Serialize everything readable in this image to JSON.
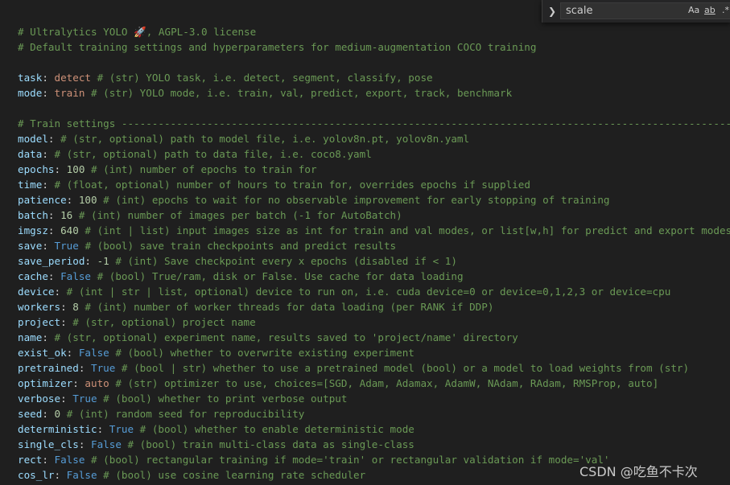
{
  "find_widget": {
    "query": "scale",
    "match_case_label": "Aa",
    "whole_word_label": "ab",
    "regex_label": ".*",
    "toggle_icon": "chevron-right-icon"
  },
  "watermark": "CSDN @吃鱼不卡次",
  "lines": [
    [
      {
        "t": "# Ultralytics YOLO 🚀, AGPL-3.0 license",
        "c": "comment"
      }
    ],
    [
      {
        "t": "# Default training settings and hyperparameters for medium-augmentation COCO training",
        "c": "comment"
      }
    ],
    [],
    [
      {
        "t": "task",
        "c": "key"
      },
      {
        "t": ": ",
        "c": "punct"
      },
      {
        "t": "detect",
        "c": "str"
      },
      {
        "t": " # (str) YOLO task, i.e. detect, segment, classify, pose",
        "c": "comment"
      }
    ],
    [
      {
        "t": "mode",
        "c": "key"
      },
      {
        "t": ": ",
        "c": "punct"
      },
      {
        "t": "train",
        "c": "str"
      },
      {
        "t": " # (str) YOLO mode, i.e. train, val, predict, export, track, benchmark",
        "c": "comment"
      }
    ],
    [],
    [
      {
        "t": "# Train settings ----------------------------------------------------------------------------------------------------------",
        "c": "comment"
      }
    ],
    [
      {
        "t": "model",
        "c": "key"
      },
      {
        "t": ":",
        "c": "punct"
      },
      {
        "t": " # (str, optional) path to model file, i.e. yolov8n.pt, yolov8n.yaml",
        "c": "comment"
      }
    ],
    [
      {
        "t": "data",
        "c": "key"
      },
      {
        "t": ":",
        "c": "punct"
      },
      {
        "t": " # (str, optional) path to data file, i.e. coco8.yaml",
        "c": "comment"
      }
    ],
    [
      {
        "t": "epochs",
        "c": "key"
      },
      {
        "t": ": ",
        "c": "punct"
      },
      {
        "t": "100",
        "c": "num"
      },
      {
        "t": " # (int) number of epochs to train for",
        "c": "comment"
      }
    ],
    [
      {
        "t": "time",
        "c": "key"
      },
      {
        "t": ":",
        "c": "punct"
      },
      {
        "t": " # (float, optional) number of hours to train for, overrides epochs if supplied",
        "c": "comment"
      }
    ],
    [
      {
        "t": "patience",
        "c": "key"
      },
      {
        "t": ": ",
        "c": "punct"
      },
      {
        "t": "100",
        "c": "num"
      },
      {
        "t": " # (int) epochs to wait for no observable improvement for early stopping of training",
        "c": "comment"
      }
    ],
    [
      {
        "t": "batch",
        "c": "key"
      },
      {
        "t": ": ",
        "c": "punct"
      },
      {
        "t": "16",
        "c": "num"
      },
      {
        "t": " # (int) number of images per batch (-1 for AutoBatch)",
        "c": "comment"
      }
    ],
    [
      {
        "t": "imgsz",
        "c": "key"
      },
      {
        "t": ": ",
        "c": "punct"
      },
      {
        "t": "640",
        "c": "num"
      },
      {
        "t": " # (int | list) input images size as int for train and val modes, or list[w,h] for predict and export modes",
        "c": "comment"
      }
    ],
    [
      {
        "t": "save",
        "c": "key"
      },
      {
        "t": ": ",
        "c": "punct"
      },
      {
        "t": "True",
        "c": "bool"
      },
      {
        "t": " # (bool) save train checkpoints and predict results",
        "c": "comment"
      }
    ],
    [
      {
        "t": "save_period",
        "c": "key"
      },
      {
        "t": ": ",
        "c": "punct"
      },
      {
        "t": "-1",
        "c": "num"
      },
      {
        "t": " # (int) Save checkpoint every x epochs (disabled if < 1)",
        "c": "comment"
      }
    ],
    [
      {
        "t": "cache",
        "c": "key"
      },
      {
        "t": ": ",
        "c": "punct"
      },
      {
        "t": "False",
        "c": "bool"
      },
      {
        "t": " # (bool) True/ram, disk or False. Use cache for data loading",
        "c": "comment"
      }
    ],
    [
      {
        "t": "device",
        "c": "key"
      },
      {
        "t": ":",
        "c": "punct"
      },
      {
        "t": " # (int | str | list, optional) device to run on, i.e. cuda device=0 or device=0,1,2,3 or device=cpu",
        "c": "comment"
      }
    ],
    [
      {
        "t": "workers",
        "c": "key"
      },
      {
        "t": ": ",
        "c": "punct"
      },
      {
        "t": "8",
        "c": "num"
      },
      {
        "t": " # (int) number of worker threads for data loading (per RANK if DDP)",
        "c": "comment"
      }
    ],
    [
      {
        "t": "project",
        "c": "key"
      },
      {
        "t": ":",
        "c": "punct"
      },
      {
        "t": " # (str, optional) project name",
        "c": "comment"
      }
    ],
    [
      {
        "t": "name",
        "c": "key"
      },
      {
        "t": ":",
        "c": "punct"
      },
      {
        "t": " # (str, optional) experiment name, results saved to 'project/name' directory",
        "c": "comment"
      }
    ],
    [
      {
        "t": "exist_ok",
        "c": "key"
      },
      {
        "t": ": ",
        "c": "punct"
      },
      {
        "t": "False",
        "c": "bool"
      },
      {
        "t": " # (bool) whether to overwrite existing experiment",
        "c": "comment"
      }
    ],
    [
      {
        "t": "pretrained",
        "c": "key"
      },
      {
        "t": ": ",
        "c": "punct"
      },
      {
        "t": "True",
        "c": "bool"
      },
      {
        "t": " # (bool | str) whether to use a pretrained model (bool) or a model to load weights from (str)",
        "c": "comment"
      }
    ],
    [
      {
        "t": "optimizer",
        "c": "key"
      },
      {
        "t": ": ",
        "c": "punct"
      },
      {
        "t": "auto",
        "c": "str"
      },
      {
        "t": " # (str) optimizer to use, choices=[SGD, Adam, Adamax, AdamW, NAdam, RAdam, RMSProp, auto]",
        "c": "comment"
      }
    ],
    [
      {
        "t": "verbose",
        "c": "key"
      },
      {
        "t": ": ",
        "c": "punct"
      },
      {
        "t": "True",
        "c": "bool"
      },
      {
        "t": " # (bool) whether to print verbose output",
        "c": "comment"
      }
    ],
    [
      {
        "t": "seed",
        "c": "key"
      },
      {
        "t": ": ",
        "c": "punct"
      },
      {
        "t": "0",
        "c": "num"
      },
      {
        "t": " # (int) random seed for reproducibility",
        "c": "comment"
      }
    ],
    [
      {
        "t": "deterministic",
        "c": "key"
      },
      {
        "t": ": ",
        "c": "punct"
      },
      {
        "t": "True",
        "c": "bool"
      },
      {
        "t": " # (bool) whether to enable deterministic mode",
        "c": "comment"
      }
    ],
    [
      {
        "t": "single_cls",
        "c": "key"
      },
      {
        "t": ": ",
        "c": "punct"
      },
      {
        "t": "False",
        "c": "bool"
      },
      {
        "t": " # (bool) train multi-class data as single-class",
        "c": "comment"
      }
    ],
    [
      {
        "t": "rect",
        "c": "key"
      },
      {
        "t": ": ",
        "c": "punct"
      },
      {
        "t": "False",
        "c": "bool"
      },
      {
        "t": " # (bool) rectangular training if mode='train' or rectangular validation if mode='val'",
        "c": "comment"
      }
    ],
    [
      {
        "t": "cos_lr",
        "c": "key"
      },
      {
        "t": ": ",
        "c": "punct"
      },
      {
        "t": "False",
        "c": "bool"
      },
      {
        "t": " # (bool) use cosine learning rate scheduler",
        "c": "comment"
      }
    ]
  ]
}
